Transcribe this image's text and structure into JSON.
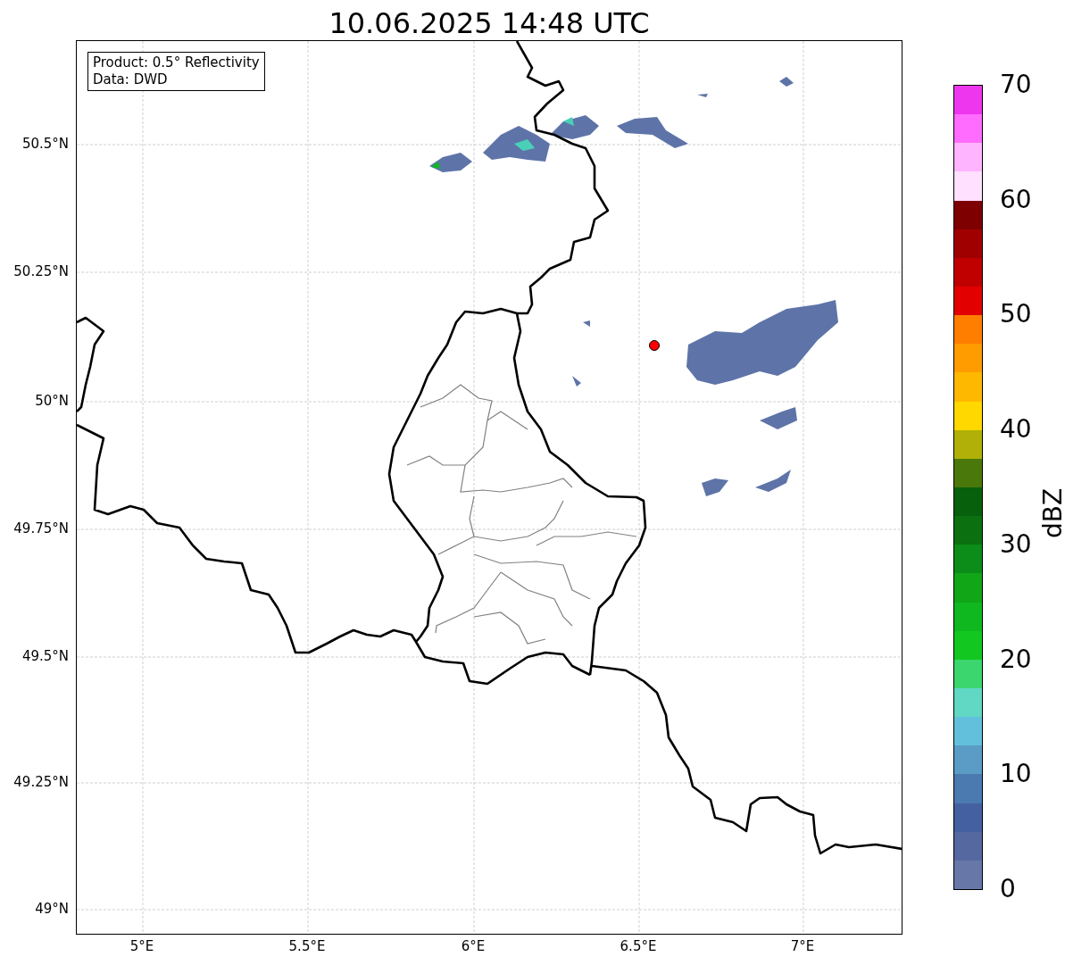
{
  "title": "10.06.2025 14:48 UTC",
  "info_box": {
    "lines": [
      "Product: 0.5° Reflectivity",
      "Data: DWD"
    ]
  },
  "map": {
    "x_ticks": [
      "5°E",
      "5.5°E",
      "6°E",
      "6.5°E",
      "7°E"
    ],
    "y_ticks": [
      "50.5°N",
      "50.25°N",
      "50°N",
      "49.75°N",
      "49.5°N",
      "49.25°N",
      "49°N"
    ]
  },
  "colorbar": {
    "label": "dBZ",
    "ticks": [
      "70",
      "60",
      "50",
      "40",
      "30",
      "20",
      "10",
      "0"
    ],
    "bands": [
      {
        "color": "#ee36ee"
      },
      {
        "color": "#ff6cff"
      },
      {
        "color": "#ffb4ff"
      },
      {
        "color": "#ffe0ff"
      },
      {
        "color": "#7e0000"
      },
      {
        "color": "#a00000"
      },
      {
        "color": "#c00000"
      },
      {
        "color": "#e20000"
      },
      {
        "color": "#ff7e00"
      },
      {
        "color": "#ff9c00"
      },
      {
        "color": "#ffb800"
      },
      {
        "color": "#ffd800"
      },
      {
        "color": "#b0b008"
      },
      {
        "color": "#4a780a"
      },
      {
        "color": "#06600c"
      },
      {
        "color": "#0a7010"
      },
      {
        "color": "#0c8c18"
      },
      {
        "color": "#10a618"
      },
      {
        "color": "#10b820"
      },
      {
        "color": "#12c820"
      },
      {
        "color": "#3cd66e"
      },
      {
        "color": "#60d8c4"
      },
      {
        "color": "#63c0dc"
      },
      {
        "color": "#5a9cc6"
      },
      {
        "color": "#4a7ab0"
      },
      {
        "color": "#4560a0"
      },
      {
        "color": "#5568a0"
      },
      {
        "color": "#6677a8"
      }
    ]
  }
}
